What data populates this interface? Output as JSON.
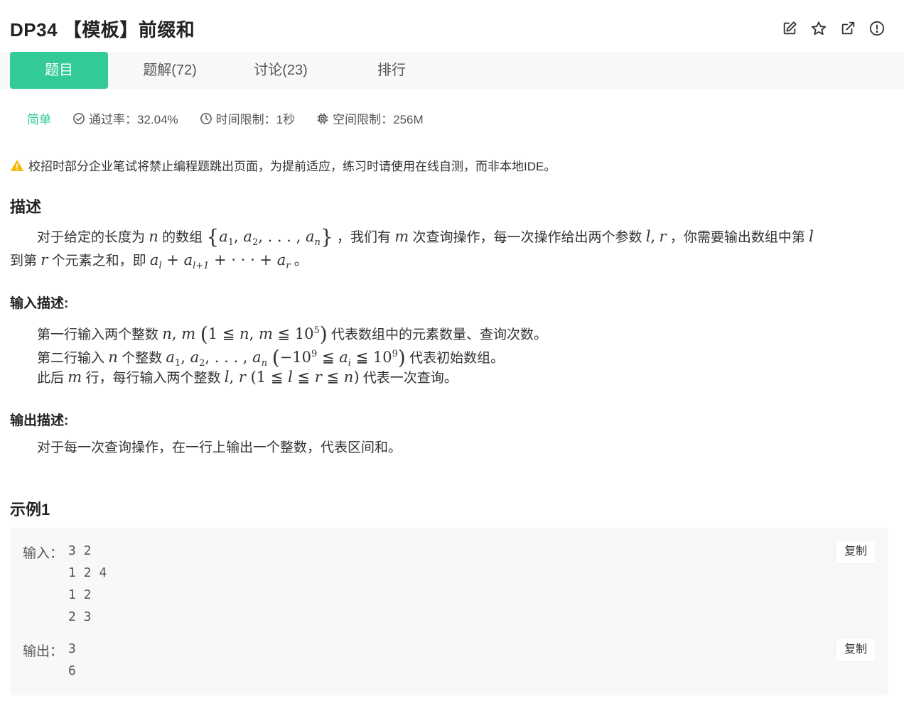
{
  "header": {
    "title": "DP34 【模板】前缀和"
  },
  "header_icons": [
    "edit-icon",
    "star-icon",
    "external-link-icon",
    "alert-circle-icon"
  ],
  "tabs": [
    {
      "label": "题目",
      "active": true
    },
    {
      "label": "题解(72)",
      "active": false
    },
    {
      "label": "讨论(23)",
      "active": false
    },
    {
      "label": "排行",
      "active": false
    }
  ],
  "meta": {
    "difficulty": "简单",
    "pass_rate": "通过率：32.04%",
    "time_limit": "时间限制：1秒",
    "memory_limit": "空间限制：256M"
  },
  "warning": "校招时部分企业笔试将禁止编程题跳出页面，为提前适应，练习时请使用在线自测，而非本地IDE。",
  "description": {
    "heading": "描述",
    "t1": "对于给定的长度为",
    "t2": "的数组",
    "t3": "，我们有",
    "t4": "次查询操作，每一次操作给出两个参数",
    "t5": "，你需要输出数组中第",
    "t6": "到第",
    "t7": "个元素之和，即",
    "t8": "。"
  },
  "input": {
    "heading": "输入描述:",
    "l1a": "第一行输入两个整数",
    "l1b": "代表数组中的元素数量、查询次数。",
    "l2a": "第二行输入",
    "l2b": "个整数",
    "l2c": "代表初始数组。",
    "l3a": "此后",
    "l3b": "行，每行输入两个整数",
    "l3c": "代表一次查询。"
  },
  "output": {
    "heading": "输出描述:",
    "text": "对于每一次查询操作，在一行上输出一个整数，代表区间和。"
  },
  "sample": {
    "heading": "示例1",
    "input_label": "输入：",
    "input_lines": [
      "3 2",
      "1 2 4",
      "1 2",
      "2 3"
    ],
    "output_label": "输出：",
    "output_lines": [
      "3",
      "6"
    ],
    "copy_label": "复制"
  },
  "colors": {
    "accent": "#32ca99",
    "warning": "#f5b800",
    "tabbar_bg": "#f7f8fa"
  }
}
